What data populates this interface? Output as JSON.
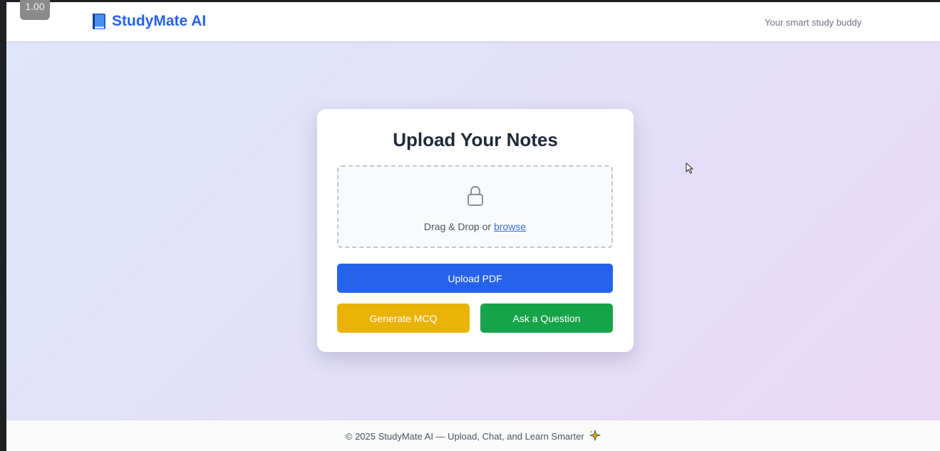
{
  "zoom_level": "1.00",
  "header": {
    "brand_name": "StudyMate AI",
    "tagline": "Your smart study buddy"
  },
  "card": {
    "title": "Upload Your Notes",
    "dropzone": {
      "text": "Drag & Drop or",
      "browse_link": "browse"
    },
    "buttons": {
      "upload": "Upload PDF",
      "generate_mcq": "Generate MCQ",
      "ask_question": "Ask a Question"
    }
  },
  "footer": {
    "text": "© 2025 StudyMate AI — Upload, Chat, and Learn Smarter"
  },
  "icons": {
    "brand": "book-icon",
    "dropzone": "lock-icon",
    "footer": "sparkle-icon"
  },
  "colors": {
    "brand": "#2563eb",
    "upload_button": "#2563eb",
    "mcq_button": "#eab308",
    "ask_button": "#16a34a"
  }
}
